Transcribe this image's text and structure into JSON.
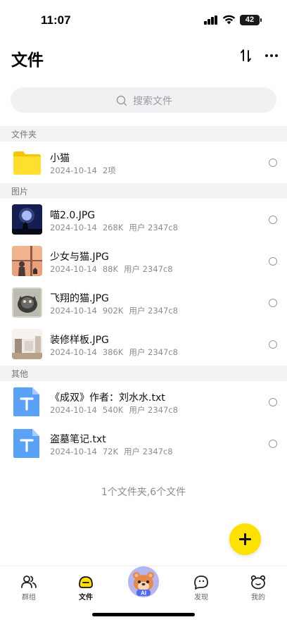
{
  "status_bar": {
    "time": "11:07",
    "battery": "42"
  },
  "header": {
    "title": "文件"
  },
  "search": {
    "placeholder": "搜索文件"
  },
  "sections": {
    "folders": "文件夹",
    "images": "图片",
    "others": "其他"
  },
  "folders": [
    {
      "name": "小猫",
      "date": "2024-10-14",
      "count": "2项"
    }
  ],
  "images": [
    {
      "name": "喵2.0.JPG",
      "date": "2024-10-14",
      "size": "268K",
      "owner": "用户 2347c8",
      "icon": "night-cat-thumbnail"
    },
    {
      "name": "少女与猫.JPG",
      "date": "2024-10-14",
      "size": "88K",
      "owner": "用户 2347c8",
      "icon": "girl-cat-thumbnail"
    },
    {
      "name": "飞翔的猫.JPG",
      "date": "2024-10-14",
      "size": "902K",
      "owner": "用户 2347c8",
      "icon": "flying-cat-thumbnail"
    },
    {
      "name": "装修样板.JPG",
      "date": "2024-10-14",
      "size": "386K",
      "owner": "用户 2347c8",
      "icon": "interior-thumbnail"
    }
  ],
  "others": [
    {
      "name": "《成双》作者：刘水水.txt",
      "date": "2024-10-14",
      "size": "540K",
      "owner": "用户 2347c8",
      "icon": "txt-file-icon"
    },
    {
      "name": "盗墓笔记.txt",
      "date": "2024-10-14",
      "size": "72K",
      "owner": "用户 2347c8",
      "icon": "txt-file-icon"
    }
  ],
  "summary": "1个文件夹,6个文件",
  "tabs": [
    {
      "label": "群组",
      "icon": "group-icon"
    },
    {
      "label": "文件",
      "icon": "file-icon"
    },
    {
      "label": "AI",
      "icon": "ai-bear-icon"
    },
    {
      "label": "发现",
      "icon": "discover-icon"
    },
    {
      "label": "我的",
      "icon": "profile-icon"
    }
  ],
  "colors": {
    "accent": "#ffe100",
    "txt_icon": "#5aa2f5",
    "folder": "#ffd91a",
    "ai_bg": "#b6b6ef"
  }
}
